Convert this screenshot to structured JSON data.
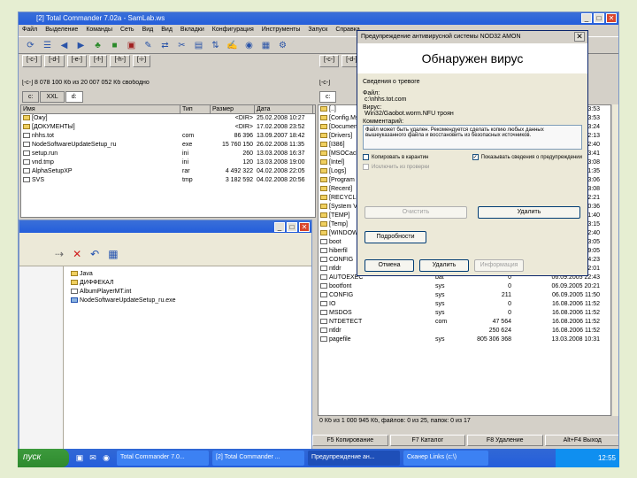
{
  "window": {
    "title": "[2] Total Commander 7.02a - SamLab.ws",
    "controls": [
      "_",
      "□",
      "✕"
    ]
  },
  "menu": [
    "Файл",
    "Выделение",
    "Команды",
    "Сеть",
    "Вид",
    "Вид",
    "Вкладки",
    "Конфигурация",
    "Инструменты",
    "Запуск",
    "Справка"
  ],
  "toolbar_icons": [
    "refresh-icon",
    "tree-icon",
    "back-icon",
    "forward-icon",
    "pack-icon",
    "unpack-icon",
    "find-icon",
    "rename-icon",
    "ftp-icon",
    "disconnect-icon",
    "compare-icon",
    "sync-icon",
    "edit-icon",
    "view-icon",
    "notepad-icon",
    "settings-icon"
  ],
  "left": {
    "drives": [
      "[-c-]",
      "[-d-]",
      "[-e-]",
      "[-f-]",
      "[-h-]",
      "[-i-]"
    ],
    "path_info": "[-c-] 8 078 100 Кб из 20 007 052 Кб свободно",
    "tabs": [
      "c:",
      "XXL",
      "d:"
    ],
    "headers": [
      "Имя",
      "Тип",
      "Размер",
      "Дата"
    ],
    "rows": [
      {
        "name": "[Ожу]",
        "type": "",
        "size": "<DIR>",
        "date": "25.02.2008 10:27"
      },
      {
        "name": "[ДОКУМЕНТЫ]",
        "type": "",
        "size": "<DIR>",
        "date": "17.02.2008 23:52"
      },
      {
        "name": "nhhs.tot",
        "type": "com",
        "size": "86 396",
        "date": "13.09.2007 18:42"
      },
      {
        "name": "NodeSoftwareUpdateSetup_ru",
        "type": "exe",
        "size": "15 760 150",
        "date": "26.02.2008 11:35"
      },
      {
        "name": "setup.run",
        "type": "ini",
        "size": "260",
        "date": "13.03.2008 16:37"
      },
      {
        "name": "vnd.tmp",
        "type": "ini",
        "size": "120",
        "date": "13.03.2008 19:00"
      },
      {
        "name": "AlphaSetupXP",
        "type": "rar",
        "size": "4 492 322",
        "date": "04.02.2008 22:05"
      },
      {
        "name": "SVS",
        "type": "tmp",
        "size": "3 182 592",
        "date": "04.02.2008 20:56"
      }
    ]
  },
  "explorer": {
    "list": [
      "Java",
      "ДИФФЕКАЛ",
      "AlbumPlayerMT.int",
      "NodeSoftwareUpdateSetup_ru.exe"
    ]
  },
  "right": {
    "drives": [
      "[-c-]",
      "[-d-]"
    ],
    "path_info": "[-c-]",
    "tab": "c:",
    "rows": [
      {
        "name": "[..]",
        "ext": "",
        "size": "",
        "date": "13:53"
      },
      {
        "name": "[Config.Ms]",
        "ext": "",
        "size": "",
        "date": "13:53"
      },
      {
        "name": "[Documents]",
        "ext": "",
        "size": "",
        "date": "13:24"
      },
      {
        "name": "[Drivers]",
        "ext": "",
        "size": "",
        "date": "12:13"
      },
      {
        "name": "[I386]",
        "ext": "",
        "size": "",
        "date": "12:40"
      },
      {
        "name": "[MSOCache]",
        "ext": "",
        "size": "",
        "date": "13:41"
      },
      {
        "name": "[Intel]",
        "ext": "",
        "size": "",
        "date": "13:08"
      },
      {
        "name": "[Logs]",
        "ext": "",
        "size": "",
        "date": "11:35"
      },
      {
        "name": "[Program Files]",
        "ext": "",
        "size": "",
        "date": "13:06"
      },
      {
        "name": "[Recent]",
        "ext": "",
        "size": "",
        "date": "13:08"
      },
      {
        "name": "[RECYCLER]",
        "ext": "",
        "size": "",
        "date": "12:21"
      },
      {
        "name": "[System Volume]",
        "ext": "",
        "size": "",
        "date": "10:36"
      },
      {
        "name": "[TEMP]",
        "ext": "",
        "size": "",
        "date": "11:40"
      },
      {
        "name": "[Temp]",
        "ext": "",
        "size": "",
        "date": "13:15"
      },
      {
        "name": "[WINDOWS]",
        "ext": "",
        "size": "",
        "date": "12:40"
      },
      {
        "name": "boot",
        "ext": "ini",
        "size": "<DIR>",
        "date": "06.09.2005 13:05"
      },
      {
        "name": "hiberfil",
        "ext": "sys",
        "size": "805 306 368",
        "date": "13.03.2008 09:05"
      },
      {
        "name": "CONFIG",
        "ext": "reg",
        "size": "49 360",
        "date": "06.09.2005 14:23"
      },
      {
        "name": "ntldr",
        "ext": "",
        "size": "2 558",
        "date": "06.09.2005 12:01"
      },
      {
        "name": "AUTOEXEC",
        "ext": "bat",
        "size": "0",
        "date": "06.09.2005 22:43"
      },
      {
        "name": "bootfont",
        "ext": "sys",
        "size": "0",
        "date": "06.09.2005 20:21"
      },
      {
        "name": "CONFIG",
        "ext": "sys",
        "size": "211",
        "date": "06.09.2005 11:50"
      },
      {
        "name": "IO",
        "ext": "sys",
        "size": "0",
        "date": "16.08.2006 11:52"
      },
      {
        "name": "MSDOS",
        "ext": "sys",
        "size": "0",
        "date": "16.08.2006 11:52"
      },
      {
        "name": "NTDETECT",
        "ext": "com",
        "size": "47 564",
        "date": "16.08.2006 11:52"
      },
      {
        "name": "ntldr",
        "ext": "",
        "size": "250 624",
        "date": "16.08.2006 11:52"
      },
      {
        "name": "pagefile",
        "ext": "sys",
        "size": "805 306 368",
        "date": "13.03.2008 10:31"
      }
    ],
    "status": "0 Кб из 1 000 945 Кб, файлов: 0 из 25, папок: 0 из 17"
  },
  "fkeys": [
    "F5 Копирование",
    "F7 Каталог",
    "F8 Удаление",
    "Alt+F4 Выход"
  ],
  "dialog": {
    "title": "Предупреждение антивирусной системы NOD32 AMON",
    "heading": "Обнаружен вирус",
    "section": "Сведения о тревоге",
    "file_label": "Файл:",
    "file_value": "c:\\nhhs.tot.com",
    "virus_label": "Вирус:",
    "virus_value": "Win32/Gaobot.worm.NFU троян",
    "comment_label": "Комментарий:",
    "comment_text": "Файл может быть удален. Рекомендуется сделать копию любых данных вышеуказанного файла и восстановить из безопасных источников.",
    "chk_quarantine": "Копировать в карантин",
    "chk_details": "Показывать сведения о предупреждении",
    "chk_exclude": "Исключить из проверки",
    "btn_clean": "Очистить",
    "btn_delete_main": "Удалить",
    "btn_more": "Подробности",
    "btn_stop": "Отмена",
    "btn_delete": "Удалить",
    "btn_info": "Информация"
  },
  "taskbar": {
    "start": "пуск",
    "items": [
      "Total Commander 7.0...",
      "[2] Total Commander ...",
      "Предупреждение ан...",
      "Сканер Links (c:\\)"
    ],
    "time": "12:55"
  }
}
